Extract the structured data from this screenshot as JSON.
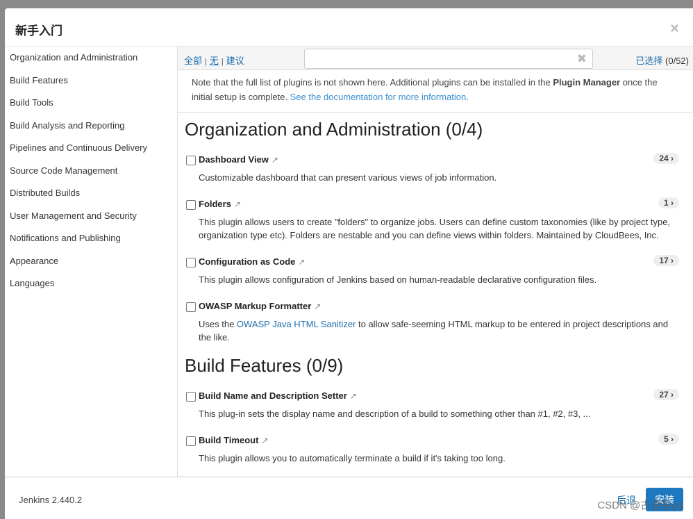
{
  "dialog": {
    "title": "新手入门",
    "close": "×"
  },
  "sidebar": {
    "items": [
      "Organization and Administration",
      "Build Features",
      "Build Tools",
      "Build Analysis and Reporting",
      "Pipelines and Continuous Delivery",
      "Source Code Management",
      "Distributed Builds",
      "User Management and Security",
      "Notifications and Publishing",
      "Appearance",
      "Languages"
    ]
  },
  "toolbar": {
    "all": "全部",
    "sep": "|",
    "none": "无",
    "suggested": "建议",
    "search_value": "",
    "clear": "✖",
    "selected_label": "已选择",
    "selected_count": "(0/52)"
  },
  "note": {
    "text1": "Note that the full list of plugins is not shown here. Additional plugins can be installed in the ",
    "bold": "Plugin Manager",
    "text2": " once the initial setup is complete. ",
    "link": "See the documentation for more information",
    "end": "."
  },
  "sections": [
    {
      "title": "Organization and Administration (0/4)",
      "plugins": [
        {
          "name": "Dashboard View",
          "count": "24 ›",
          "desc": "Customizable dashboard that can present various views of job information."
        },
        {
          "name": "Folders",
          "count": "1 ›",
          "desc": "This plugin allows users to create \"folders\" to organize jobs. Users can define custom taxonomies (like by project type, organization type etc). Folders are nestable and you can define views within folders. Maintained by CloudBees, Inc."
        },
        {
          "name": "Configuration as Code",
          "count": "17 ›",
          "desc": "This plugin allows configuration of Jenkins based on human-readable declarative configuration files."
        },
        {
          "name": "OWASP Markup Formatter",
          "count": "",
          "desc_pre": "Uses the ",
          "desc_link": "OWASP Java HTML Sanitizer",
          "desc_post": " to allow safe-seeming HTML markup to be entered in project descriptions and the like."
        }
      ]
    },
    {
      "title": "Build Features (0/9)",
      "plugins": [
        {
          "name": "Build Name and Description Setter",
          "count": "27 ›",
          "desc": "This plug-in sets the display name and description of a build to something other than #1, #2, #3, ..."
        },
        {
          "name": "Build Timeout",
          "count": "5 ›",
          "desc": "This plugin allows you to automatically terminate a build if it's taking too long."
        }
      ]
    }
  ],
  "footer": {
    "version": "Jenkins 2.440.2",
    "back": "后退",
    "install": "安装"
  },
  "watermark": "CSDN @古德曼gd",
  "icons": {
    "external": "↗"
  },
  "colors": {
    "link": "#1e6fae",
    "primary": "#1e78c0"
  }
}
